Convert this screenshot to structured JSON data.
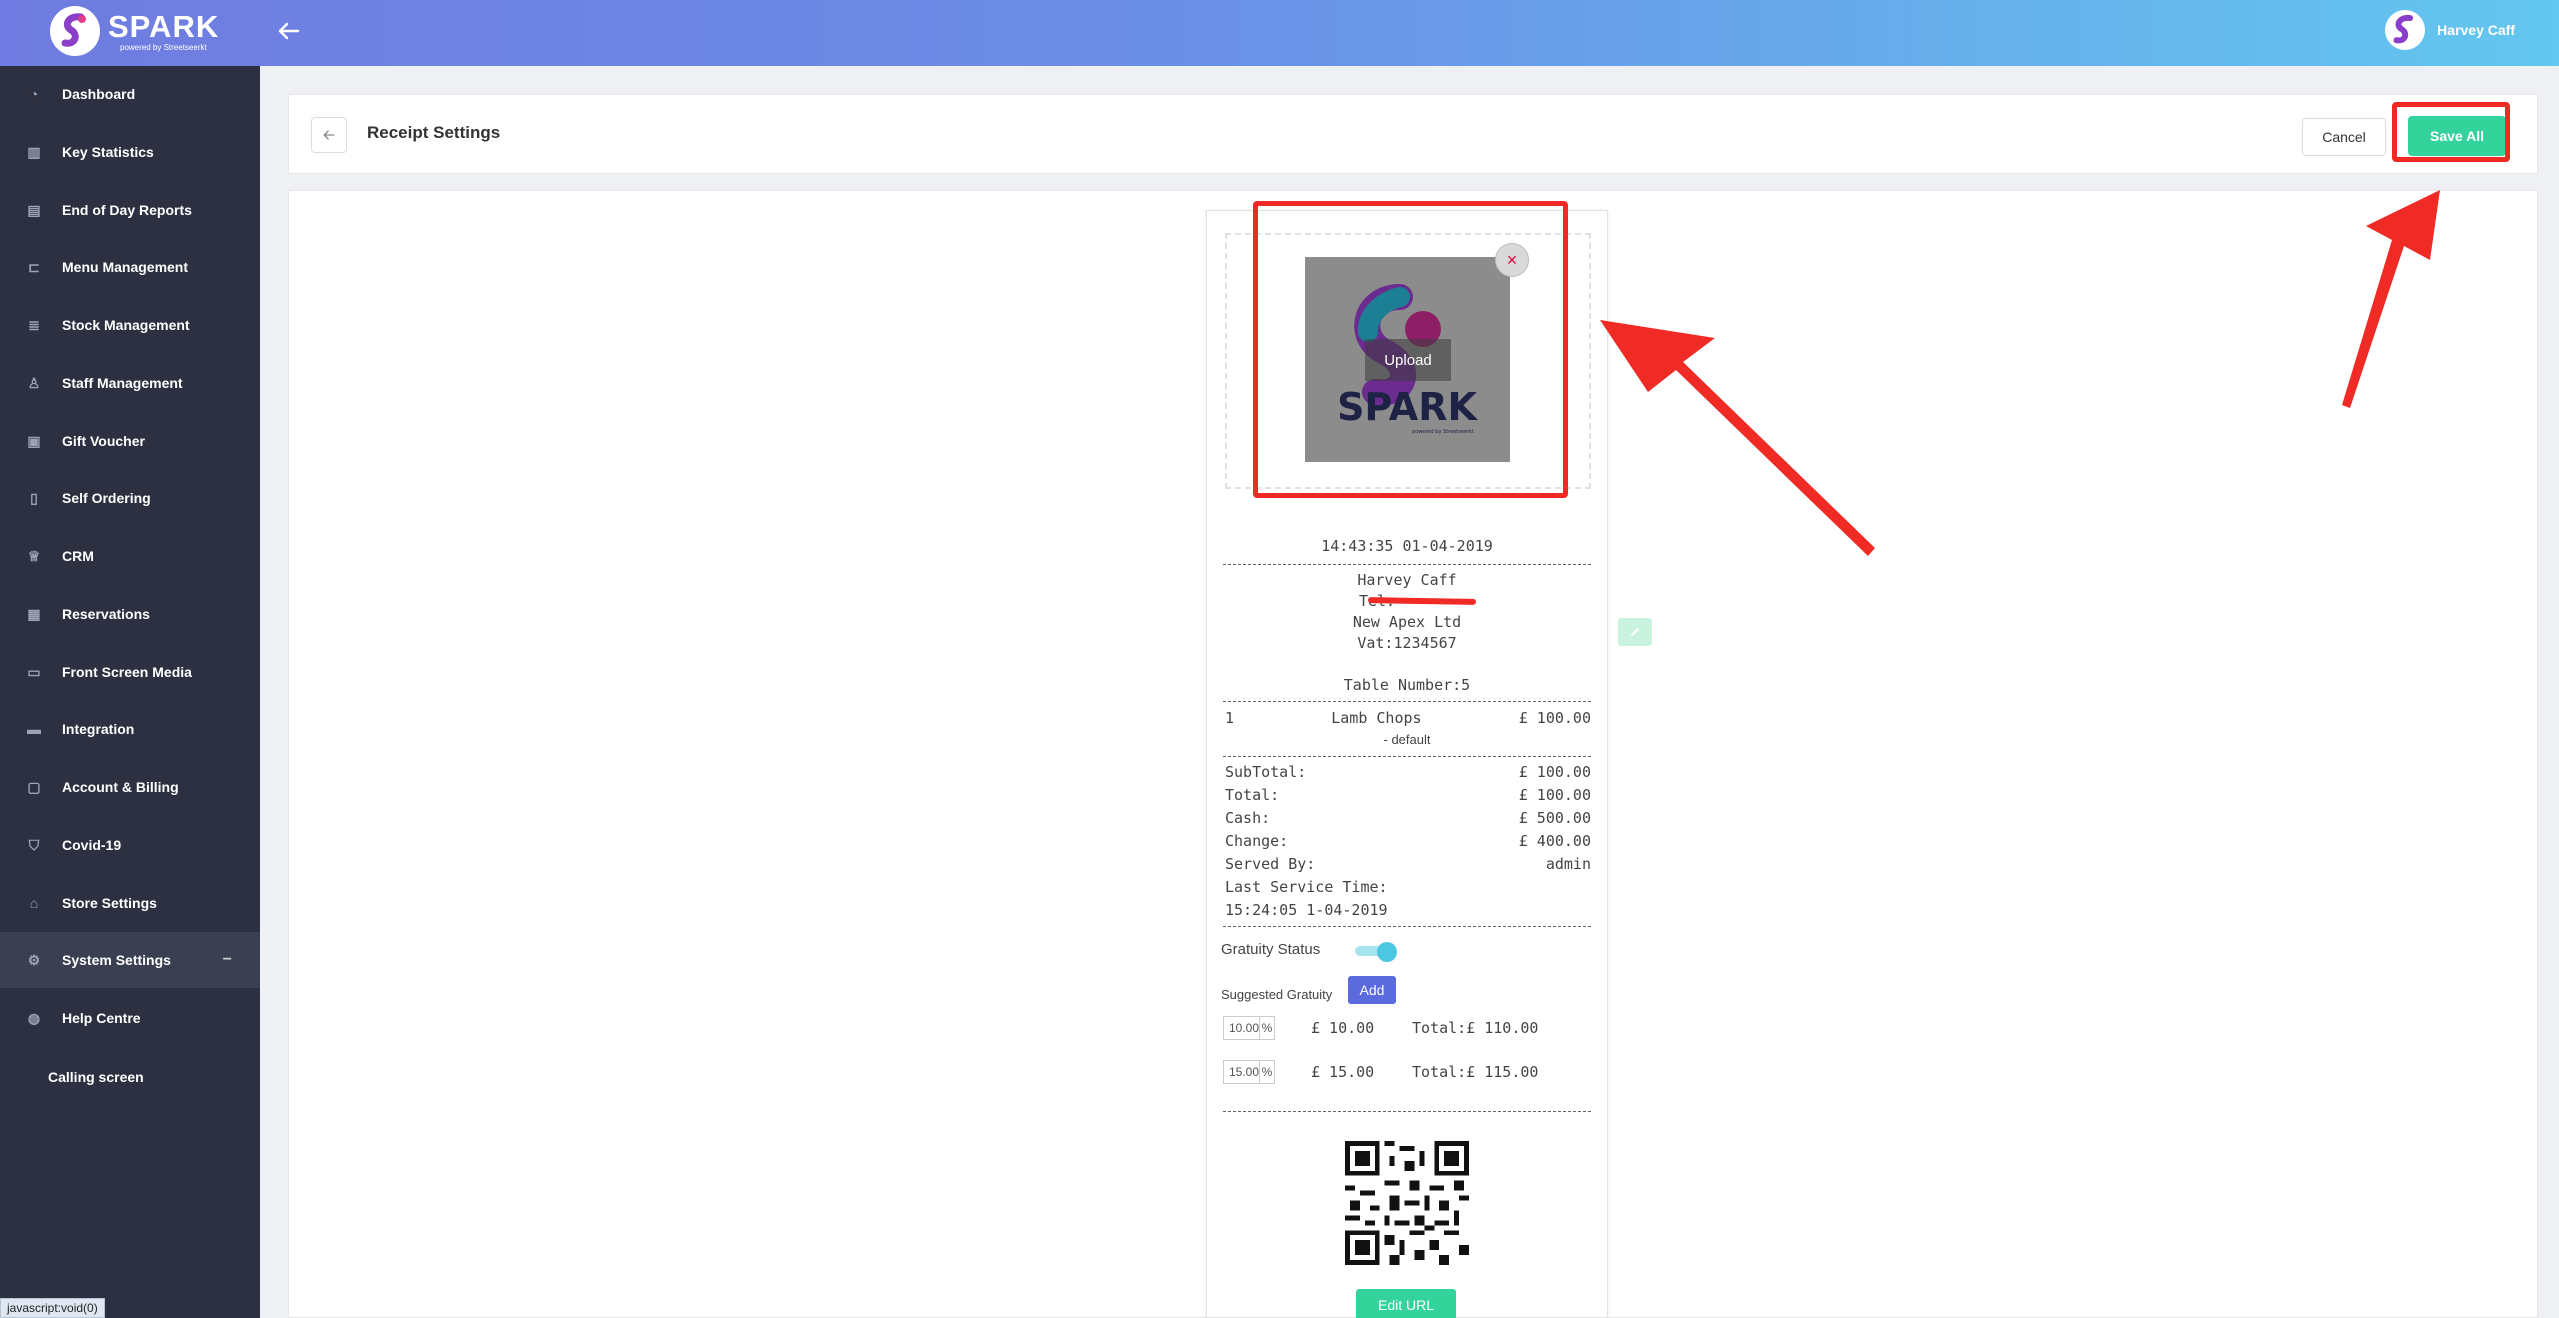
{
  "app": {
    "name": "SPARK",
    "tagline": "powered by Streetseerkt"
  },
  "user": {
    "name": "Harvey Caff"
  },
  "sidebar": {
    "items": [
      {
        "label": "Dashboard",
        "icon": "dashboard-icon"
      },
      {
        "label": "Key Statistics",
        "icon": "bar-chart-icon"
      },
      {
        "label": "End of Day Reports",
        "icon": "report-icon"
      },
      {
        "label": "Menu Management",
        "icon": "cart-icon"
      },
      {
        "label": "Stock Management",
        "icon": "database-icon"
      },
      {
        "label": "Staff Management",
        "icon": "person-icon"
      },
      {
        "label": "Gift Voucher",
        "icon": "gift-icon"
      },
      {
        "label": "Self Ordering",
        "icon": "tablet-icon"
      },
      {
        "label": "CRM",
        "icon": "crown-icon"
      },
      {
        "label": "Reservations",
        "icon": "calendar-icon"
      },
      {
        "label": "Front Screen Media",
        "icon": "laptop-icon"
      },
      {
        "label": "Integration",
        "icon": "card-icon"
      },
      {
        "label": "Account & Billing",
        "icon": "file-icon"
      },
      {
        "label": "Covid-19",
        "icon": "shield-icon"
      },
      {
        "label": "Store Settings",
        "icon": "home-icon"
      },
      {
        "label": "System Settings",
        "icon": "gear-icon",
        "active": true,
        "expanded_marker": "−"
      },
      {
        "label": "Help Centre",
        "icon": "globe-icon"
      }
    ],
    "subitems": [
      {
        "label": "Calling screen"
      }
    ]
  },
  "header": {
    "title": "Receipt Settings",
    "cancel_label": "Cancel",
    "save_label": "Save All"
  },
  "receipt": {
    "upload_label": "Upload",
    "logo_text": "SPARK",
    "logo_subtext": "powered by Streetseerkt",
    "datetime": "14:43:35 01-04-2019",
    "store_name": "Harvey Caff",
    "tel_prefix": "Tel:",
    "company": "New Apex Ltd",
    "vat": "Vat:1234567",
    "table": "Table Number:5",
    "item": {
      "qty": "1",
      "name": "Lamb Chops",
      "price": "£ 100.00",
      "modifier": "- default"
    },
    "totals": [
      {
        "label": "SubTotal:",
        "value": "£ 100.00"
      },
      {
        "label": "Total:",
        "value": "£ 100.00"
      },
      {
        "label": "Cash:",
        "value": "£ 500.00"
      },
      {
        "label": "Change:",
        "value": "£ 400.00"
      },
      {
        "label": "Served By:",
        "value": "admin"
      }
    ],
    "last_service_label": "Last Service Time:",
    "last_service_time": "15:24:05 1-04-2019",
    "gratuity_status_label": "Gratuity Status",
    "gratuity_enabled": true,
    "suggested_gratuity_label": "Suggested Gratuity",
    "add_label": "Add",
    "gratuities": [
      {
        "percent": "10.00",
        "unit": "%",
        "amount": "£ 10.00",
        "total": "Total:£ 110.00"
      },
      {
        "percent": "15.00",
        "unit": "%",
        "amount": "£ 15.00",
        "total": "Total:£ 115.00"
      }
    ],
    "edit_url_label": "Edit URL"
  },
  "status_bar": {
    "text": "javascript:void(0)"
  },
  "colors": {
    "accent": "#34d39b",
    "sidebar": "#2d3040",
    "annotation": "#f02a25",
    "primary": "#5b6bdd"
  }
}
